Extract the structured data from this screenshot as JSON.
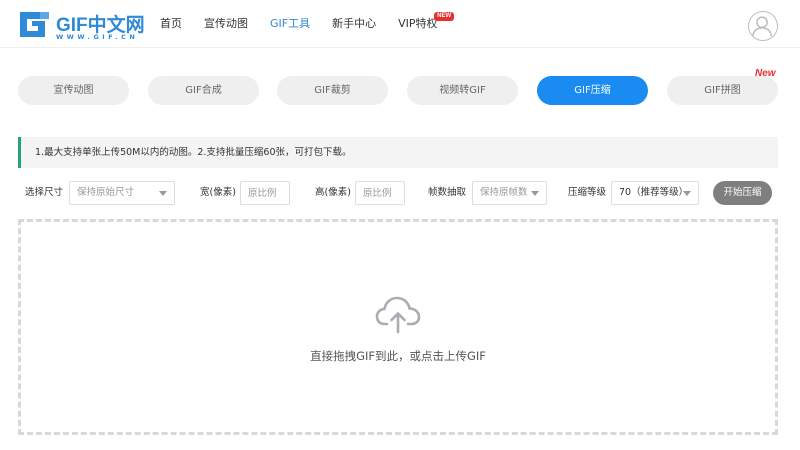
{
  "brand": {
    "name": "GIF中文网",
    "url": "WWW.GIF.CN",
    "color": "#2f8ad8"
  },
  "nav": {
    "items": [
      {
        "label": "首页"
      },
      {
        "label": "宣传动图"
      },
      {
        "label": "GIF工具",
        "active": true
      },
      {
        "label": "新手中心"
      },
      {
        "label": "VIP特权",
        "badge": "NEW"
      }
    ]
  },
  "user": {
    "avatar_icon": "user-avatar-icon"
  },
  "tabs": [
    {
      "label": "宣传动图"
    },
    {
      "label": "GIF合成"
    },
    {
      "label": "GIF裁剪"
    },
    {
      "label": "视频转GIF"
    },
    {
      "label": "GIF压缩",
      "active": true
    },
    {
      "label": "GIF拼图"
    }
  ],
  "new_tag": "New",
  "notice": "1.最大支持单张上传50M以内的动图。2.支持批量压缩60张，可打包下载。",
  "options": {
    "size_label": "选择尺寸",
    "size_value": "保持原始尺寸",
    "width_label": "宽(像素)",
    "width_placeholder": "原比例",
    "height_label": "高(像素)",
    "height_placeholder": "原比例",
    "frames_label": "帧数抽取",
    "frames_value": "保持原帧数",
    "level_label": "压缩等级",
    "level_value": "70（推荐等级）",
    "start_label": "开始压缩"
  },
  "dropzone": {
    "icon": "cloud-upload-icon",
    "text": "直接拖拽GIF到此，或点击上传GIF"
  },
  "colors": {
    "accent": "#1a8bf0",
    "notice_bar": "#2aa07a",
    "new_badge": "#e8312f",
    "button_gray": "#7f7f7f"
  }
}
